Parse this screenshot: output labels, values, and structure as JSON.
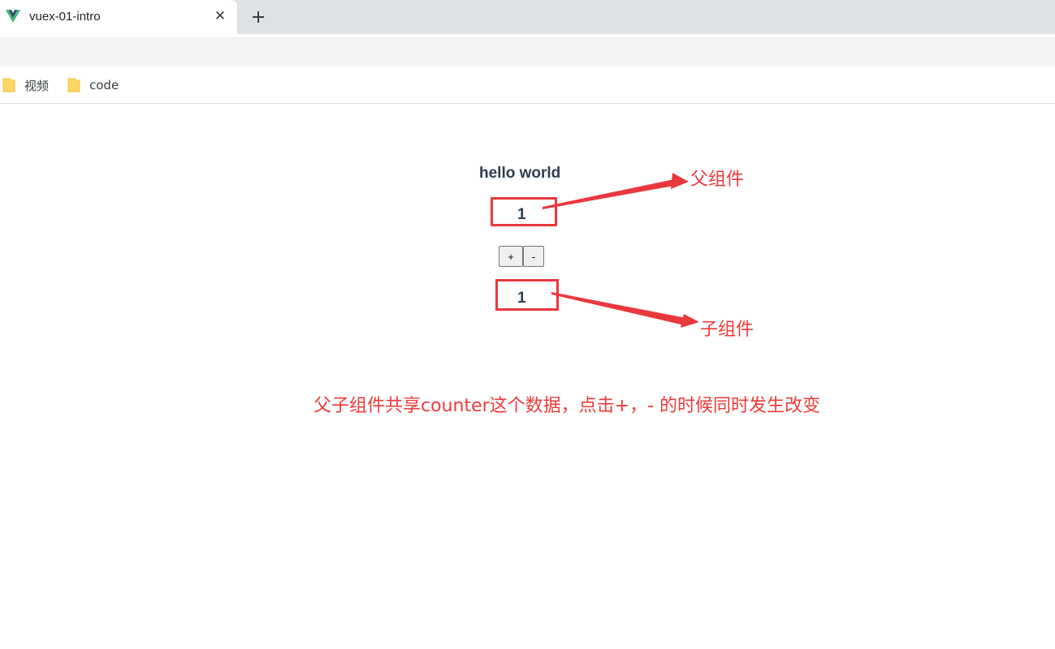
{
  "browser": {
    "tab": {
      "title": "vuex-01-intro",
      "close_glyph": "✕"
    },
    "bookmarks": [
      {
        "label": "视频",
        "icon": "folder-icon"
      },
      {
        "label": "code",
        "icon": "folder-icon"
      }
    ]
  },
  "page": {
    "title": "hello world",
    "parent_counter": "1",
    "plus_label": "+",
    "minus_label": "-",
    "child_counter": "1"
  },
  "annotations": {
    "parent_label": "父组件",
    "child_label": "子组件",
    "caption": "父子组件共享counter这个数据，点击+，- 的时候同时发生改变",
    "color": "#ee3a3a"
  },
  "colors": {
    "vue_green": "#41b883",
    "vue_dark": "#35495e",
    "folder_yellow": "#fdd663",
    "text_dark": "#2c3e50"
  }
}
